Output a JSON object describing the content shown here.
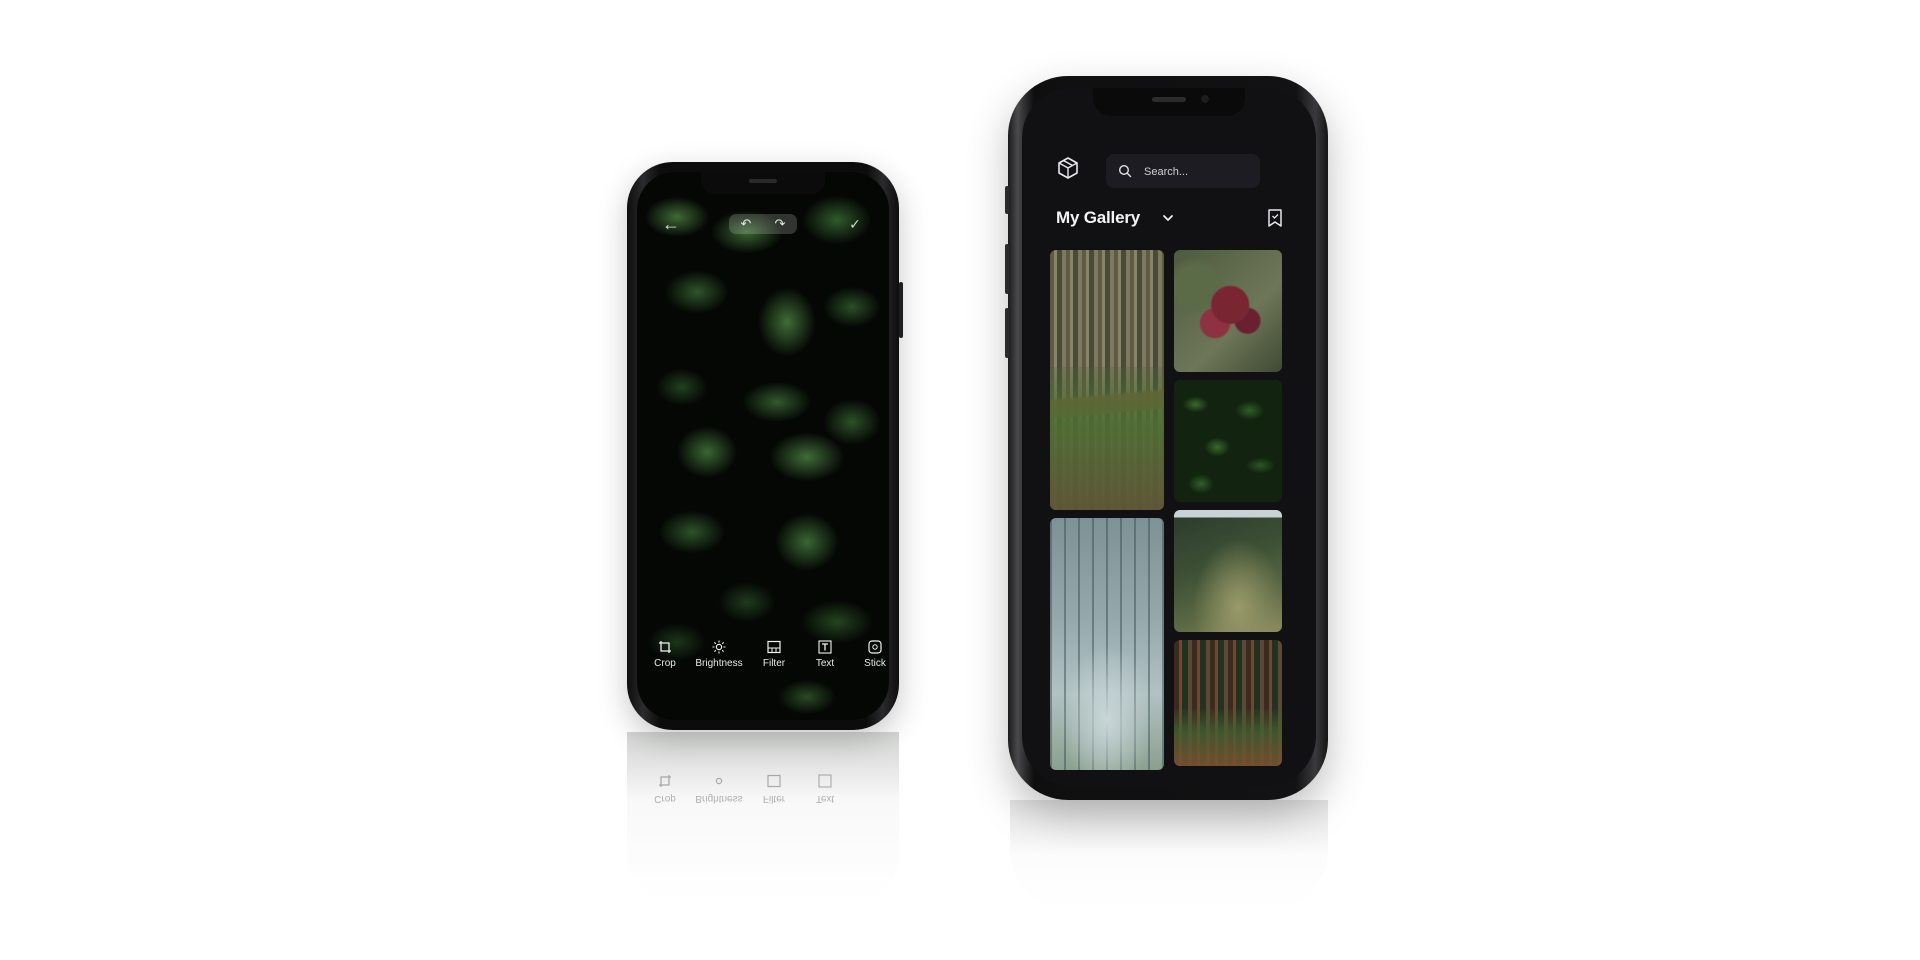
{
  "editor_phone": {
    "top_bar": {
      "back_icon": "arrow-left-icon",
      "undo_icon": "undo-icon",
      "redo_icon": "redo-icon",
      "confirm_icon": "check-icon"
    },
    "tools": [
      {
        "label": "Crop",
        "icon": "crop-icon"
      },
      {
        "label": "Brightness",
        "icon": "sun-icon"
      },
      {
        "label": "Filter",
        "icon": "filter-icon"
      },
      {
        "label": "Text",
        "icon": "text-icon"
      },
      {
        "label": "Stick",
        "icon": "sticker-icon"
      }
    ]
  },
  "gallery_phone": {
    "logo_icon": "cube-icon",
    "search": {
      "placeholder": "Search...",
      "value": "",
      "icon": "search-icon"
    },
    "title": "My Gallery",
    "dropdown_icon": "chevron-down-icon",
    "bookmark_icon": "bookmark-icon",
    "photos": [
      {
        "subject": "forest-path"
      },
      {
        "subject": "red-flowers"
      },
      {
        "subject": "green-leaves"
      },
      {
        "subject": "misty-forest-road"
      },
      {
        "subject": "hillside-grass"
      },
      {
        "subject": "redwood-trail"
      }
    ]
  },
  "colors": {
    "gallery_bg": "#111114",
    "search_bg": "#1c1c22",
    "text_light": "#f3f3f5"
  }
}
